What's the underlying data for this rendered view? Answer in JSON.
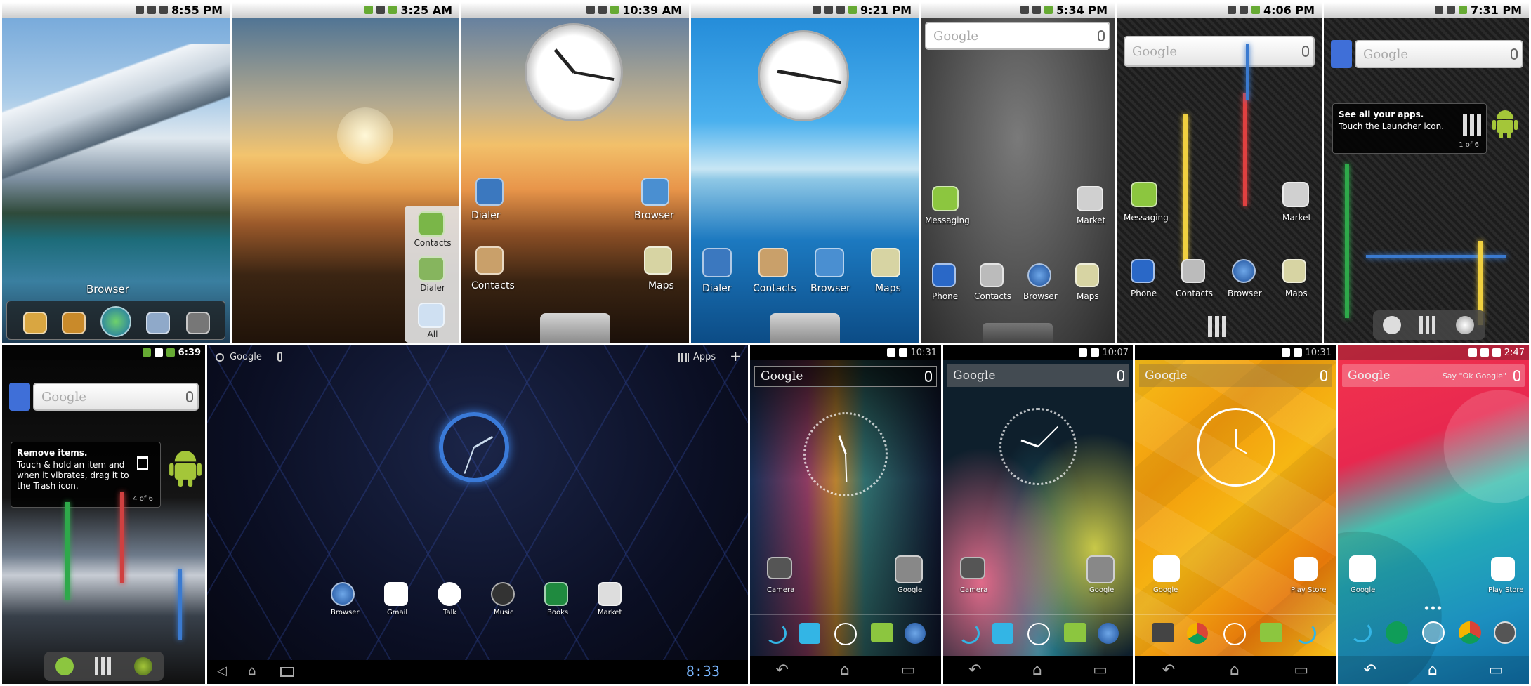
{
  "panels": {
    "p1": {
      "time": "8:55 PM",
      "label": "Browser"
    },
    "p2": {
      "time": "3:25 AM",
      "labels": [
        "Contacts",
        "Dialer",
        "All"
      ]
    },
    "p3": {
      "time": "10:39 AM",
      "labels": [
        "Dialer",
        "Browser",
        "Contacts",
        "Maps"
      ]
    },
    "p4": {
      "time": "9:21 PM",
      "labels": [
        "Dialer",
        "Contacts",
        "Browser",
        "Maps"
      ]
    },
    "p5": {
      "time": "5:34 PM",
      "search": "Google",
      "labels": [
        "Messaging",
        "Market",
        "Phone",
        "Contacts",
        "Browser",
        "Maps"
      ]
    },
    "p6": {
      "time": "4:06 PM",
      "search": "Google",
      "labels": [
        "Messaging",
        "Market",
        "Phone",
        "Contacts",
        "Browser",
        "Maps"
      ]
    },
    "p7": {
      "time": "7:31 PM",
      "search": "Google",
      "hint_title": "See all your apps.",
      "hint_body": "Touch the Launcher icon.",
      "pager": "1 of 6"
    },
    "p8": {
      "time": "6:39",
      "search": "Google",
      "hint_title": "Remove items.",
      "hint_body": "Touch & hold an item and when it vibrates, drag it to the Trash icon.",
      "pager": "4 of 6"
    },
    "p9": {
      "search": "Google",
      "apps": "Apps",
      "labels": [
        "Browser",
        "Gmail",
        "Talk",
        "Music",
        "Books",
        "Market"
      ],
      "clock": "8:33"
    },
    "p10": {
      "time": "10:31",
      "search": "Google",
      "labels": [
        "Camera",
        "Google"
      ]
    },
    "p11": {
      "time": "10:07",
      "search": "Google",
      "labels": [
        "Camera",
        "Google"
      ]
    },
    "p12": {
      "time": "10:31",
      "search": "Google",
      "labels": [
        "Google",
        "Play Store"
      ]
    },
    "p13": {
      "time": "2:47",
      "search": "Google",
      "hint": "Say \"Ok Google\"",
      "labels": [
        "Google",
        "Play Store"
      ]
    }
  },
  "colors": {
    "android_green": "#a4c639",
    "ics_blue": "#33b5e5"
  }
}
